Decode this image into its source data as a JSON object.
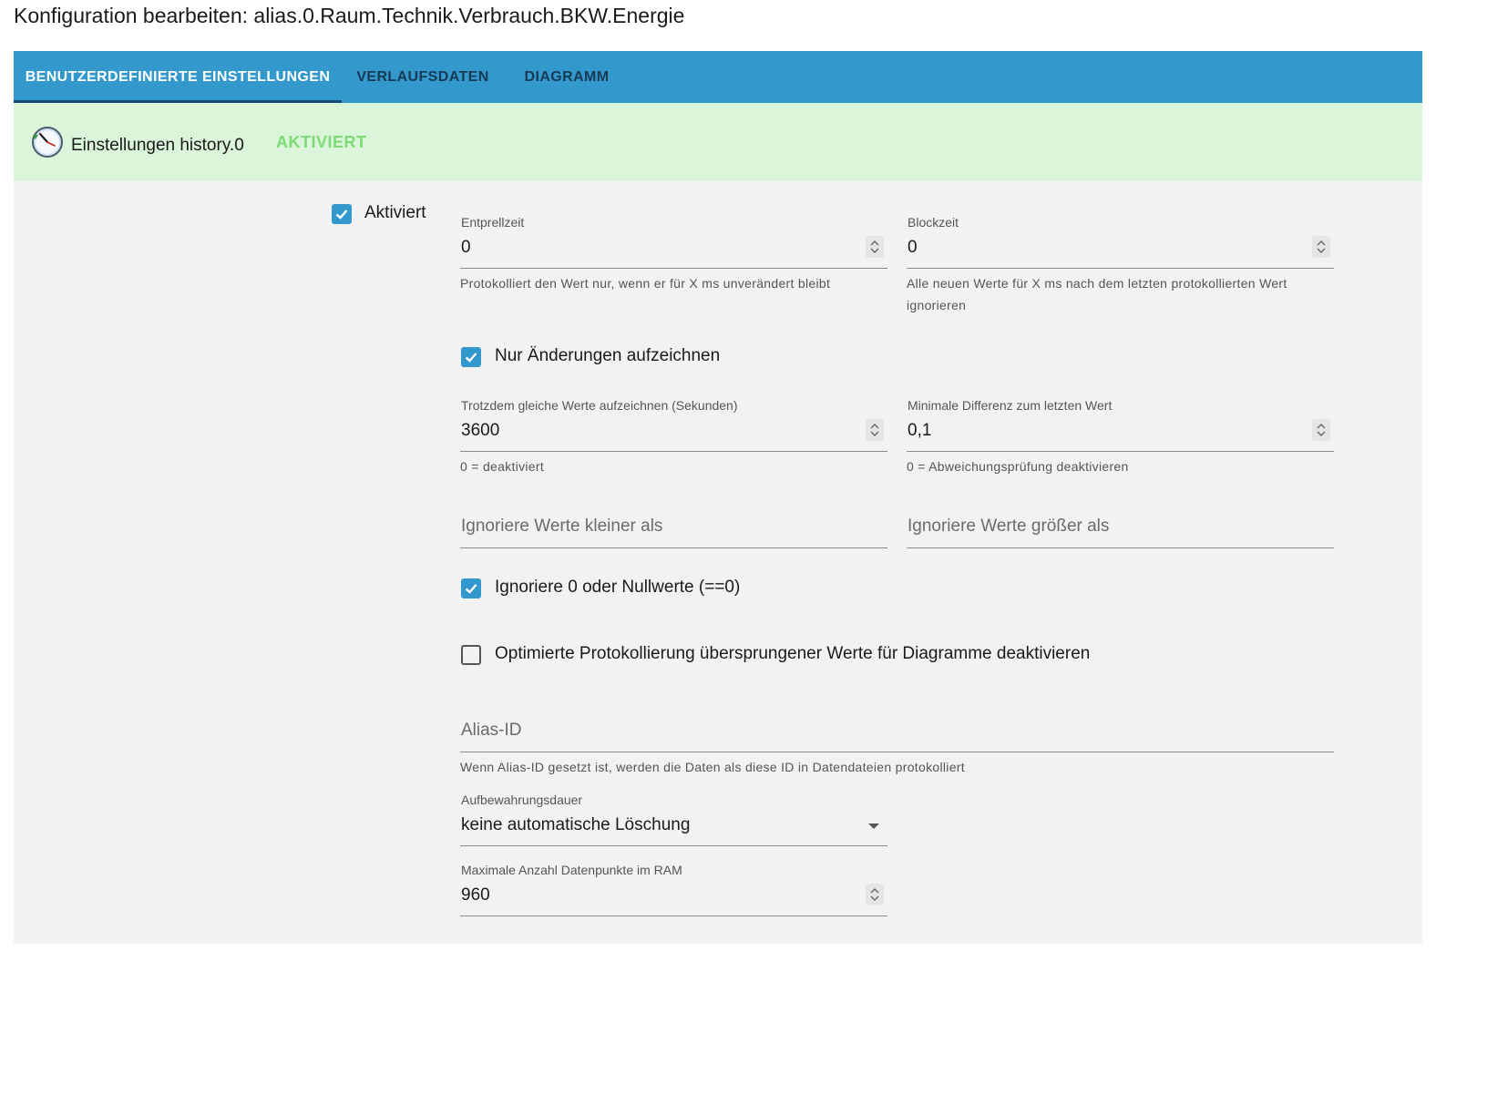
{
  "page": {
    "title": "Konfiguration bearbeiten: alias.0.Raum.Technik.Verbrauch.BKW.Energie"
  },
  "tabs": [
    {
      "label": "BENUTZERDEFINIERTE EINSTELLUNGEN",
      "active": true
    },
    {
      "label": "VERLAUFSDATEN",
      "active": false
    },
    {
      "label": "DIAGRAMM",
      "active": false
    }
  ],
  "instance": {
    "label": "Einstellungen history.0",
    "status": "AKTIVIERT",
    "icon": "clock-icon"
  },
  "settings": {
    "enabled": {
      "label": "Aktiviert",
      "checked": true
    },
    "debounce": {
      "label": "Entprellzeit",
      "value": "0",
      "helper": "Protokolliert den Wert nur, wenn er für X ms unverändert bleibt"
    },
    "blocktime": {
      "label": "Blockzeit",
      "value": "0",
      "helper": "Alle neuen Werte für X ms nach dem letzten protokollierten Wert ignorieren"
    },
    "changes_only": {
      "label": "Nur Änderungen aufzeichnen",
      "checked": true
    },
    "same_values": {
      "label": "Trotzdem gleiche Werte aufzeichnen (Sekunden)",
      "value": "3600",
      "helper": "0 = deaktiviert"
    },
    "min_diff": {
      "label": "Minimale Differenz zum letzten Wert",
      "value": "0,1",
      "helper": "0 = Abweichungsprüfung deaktivieren"
    },
    "ignore_below": {
      "placeholder": "Ignoriere Werte kleiner als"
    },
    "ignore_above": {
      "placeholder": "Ignoriere Werte größer als"
    },
    "ignore_zero": {
      "label": "Ignoriere 0 oder Nullwerte (==0)",
      "checked": true
    },
    "disable_optimized": {
      "label": "Optimierte Protokollierung übersprungener Werte für Diagramme deaktivieren",
      "checked": false
    },
    "alias_id": {
      "placeholder": "Alias-ID",
      "helper": "Wenn Alias-ID gesetzt ist, werden die Daten als diese ID in Datendateien protokolliert"
    },
    "retention": {
      "label": "Aufbewahrungsdauer",
      "value": "keine automatische Löschung"
    },
    "max_points": {
      "label": "Maximale Anzahl Datenpunkte im RAM",
      "value": "960"
    }
  },
  "colors": {
    "accent": "#3399cc",
    "active_status": "#7ddc76",
    "instance_bg": "#dbf5da",
    "panel_bg": "#f2f2f2"
  }
}
